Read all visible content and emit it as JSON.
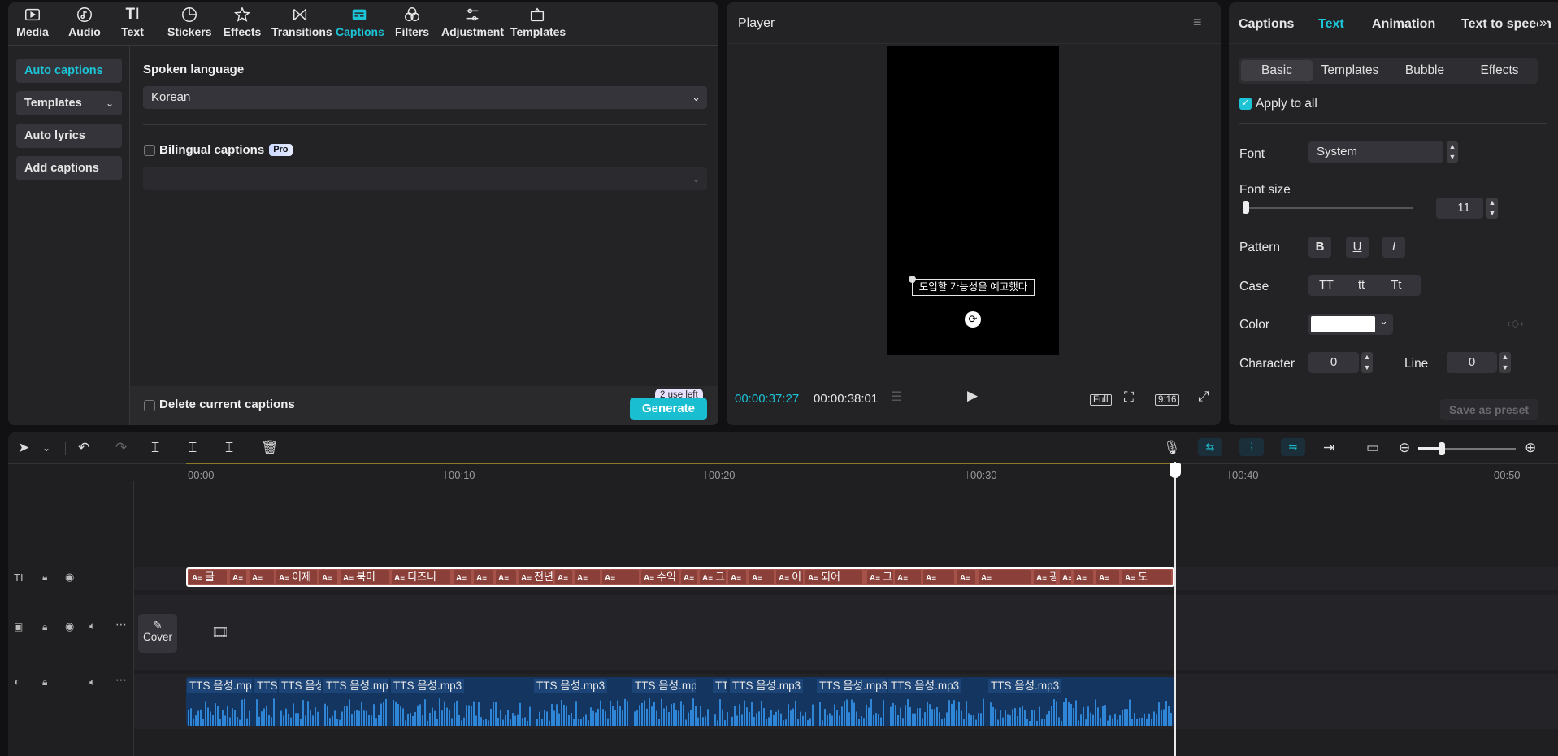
{
  "toolbar": {
    "items": [
      {
        "label": "Media",
        "icon": "media-icon"
      },
      {
        "label": "Audio",
        "icon": "audio-icon"
      },
      {
        "label": "Text",
        "icon": "text-icon"
      },
      {
        "label": "Stickers",
        "icon": "stickers-icon"
      },
      {
        "label": "Effects",
        "icon": "effects-icon"
      },
      {
        "label": "Transitions",
        "icon": "transitions-icon"
      },
      {
        "label": "Captions",
        "icon": "captions-icon"
      },
      {
        "label": "Filters",
        "icon": "filters-icon"
      },
      {
        "label": "Adjustment",
        "icon": "adjustment-icon"
      },
      {
        "label": "Templates",
        "icon": "templates-icon"
      }
    ],
    "active": "Captions"
  },
  "left_nav": {
    "items": [
      "Auto captions",
      "Templates",
      "Auto lyrics",
      "Add captions"
    ],
    "active": "Auto captions"
  },
  "captions_form": {
    "spoken_language_label": "Spoken language",
    "spoken_language_value": "Korean",
    "bilingual_label": "Bilingual captions",
    "pro_badge": "Pro",
    "delete_label": "Delete current captions",
    "generate_label": "Generate",
    "uses_left": "2 use left"
  },
  "player": {
    "title": "Player",
    "caption_preview": "도입할 가능성을 예고했다",
    "current_time": "00:00:37:27",
    "total_time": "00:00:38:01",
    "full_label": "Full",
    "ratio_label": "9:16"
  },
  "right_panel": {
    "tabs": [
      "Captions",
      "Text",
      "Animation",
      "Text to speech"
    ],
    "active_tab": "Text",
    "subtabs": [
      "Basic",
      "Templates",
      "Bubble",
      "Effects"
    ],
    "active_subtab": "Basic",
    "apply_to_all": "Apply to all",
    "font_label": "Font",
    "font_value": "System",
    "font_size_label": "Font size",
    "font_size_value": "11",
    "pattern_label": "Pattern",
    "pattern_bold": "B",
    "pattern_underline": "U",
    "pattern_italic": "I",
    "case_label": "Case",
    "case_options": [
      "TT",
      "tt",
      "Tt"
    ],
    "color_label": "Color",
    "color_value": "#ffffff",
    "character_label": "Character",
    "character_value": "0",
    "line_label": "Line",
    "line_value": "0",
    "save_preset": "Save as preset"
  },
  "timeline": {
    "ruler": [
      "00:00",
      "00:10",
      "00:20",
      "00:30",
      "00:40",
      "00:50"
    ],
    "cover_label": "Cover",
    "caption_clips": [
      "글",
      "",
      "",
      "이제",
      "",
      "북미",
      "디즈니",
      "",
      "",
      "",
      "전년",
      "",
      "",
      "",
      "수익",
      "",
      "그",
      "",
      "",
      "이",
      "되어",
      "그래",
      "",
      "",
      "",
      "",
      "광고",
      "",
      "",
      "",
      "도"
    ],
    "audio_clips": [
      "TTS 음성.mp3",
      "TTS",
      "TTS 음성",
      "TTS 음성.mp3",
      "TTS 음성.mp3",
      "TTS 음성.mp3",
      "TTS 음성.mp3",
      "TT",
      "TTS 음성.mp3",
      "TTS 음성.mp3",
      "TTS 음성.mp3",
      "TTS 음성.mp3"
    ]
  },
  "colors": {
    "accent": "#1cc4d6",
    "caption_clip": "#a6524a",
    "audio_clip": "#14355f"
  }
}
